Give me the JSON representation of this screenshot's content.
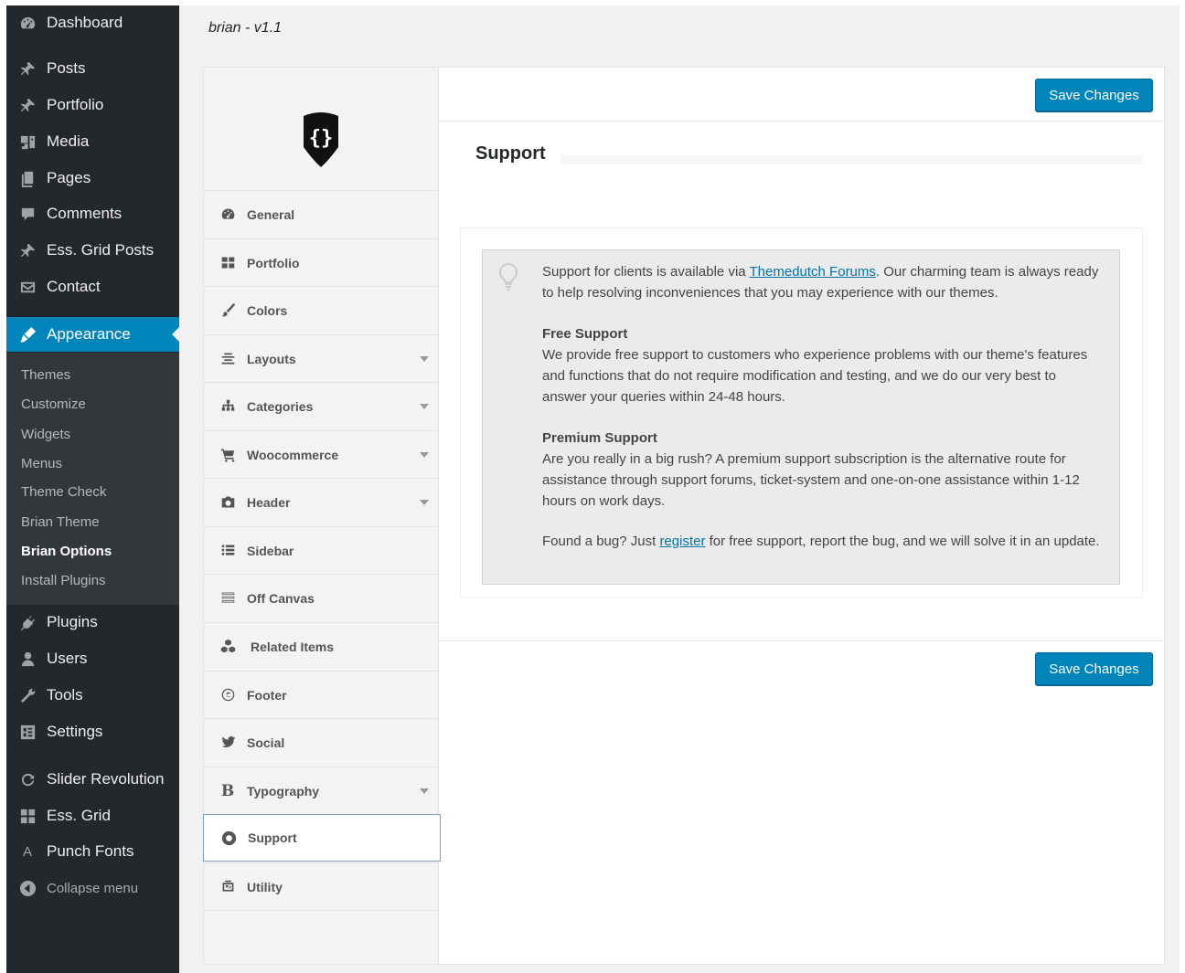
{
  "admin_menu": {
    "items": [
      {
        "label": "Dashboard",
        "icon": "dashboard-icon"
      },
      {
        "label": "Posts",
        "icon": "pin-icon"
      },
      {
        "label": "Portfolio",
        "icon": "pin-icon"
      },
      {
        "label": "Media",
        "icon": "media-icon"
      },
      {
        "label": "Pages",
        "icon": "pages-icon"
      },
      {
        "label": "Comments",
        "icon": "comment-icon"
      },
      {
        "label": "Ess. Grid Posts",
        "icon": "pin-icon"
      },
      {
        "label": "Contact",
        "icon": "mail-icon"
      },
      {
        "label": "Appearance",
        "icon": "brush-icon"
      },
      {
        "label": "Plugins",
        "icon": "plugin-icon"
      },
      {
        "label": "Users",
        "icon": "user-icon"
      },
      {
        "label": "Tools",
        "icon": "wrench-icon"
      },
      {
        "label": "Settings",
        "icon": "settings-icon"
      },
      {
        "label": "Slider Revolution",
        "icon": "refresh-icon"
      },
      {
        "label": "Ess. Grid",
        "icon": "grid-icon"
      },
      {
        "label": "Punch Fonts",
        "icon": "font-icon"
      },
      {
        "label": "Collapse menu",
        "icon": "collapse-icon"
      }
    ],
    "submenu": [
      "Themes",
      "Customize",
      "Widgets",
      "Menus",
      "Theme Check",
      "Brian Theme",
      "Brian Options",
      "Install Plugins"
    ],
    "current_submenu": "Brian Options"
  },
  "page": {
    "title": "brian - v1.1",
    "save_label": "Save Changes",
    "section_title": "Support"
  },
  "options_nav": [
    {
      "label": "General",
      "icon": "dashboard-icon",
      "has_caret": false
    },
    {
      "label": "Portfolio",
      "icon": "grid-icon",
      "has_caret": false
    },
    {
      "label": "Colors",
      "icon": "brush-icon",
      "has_caret": false
    },
    {
      "label": "Layouts",
      "icon": "align-icon",
      "has_caret": true
    },
    {
      "label": "Categories",
      "icon": "sitemap-icon",
      "has_caret": true
    },
    {
      "label": "Woocommerce",
      "icon": "cart-icon",
      "has_caret": true
    },
    {
      "label": "Header",
      "icon": "camera-icon",
      "has_caret": true
    },
    {
      "label": "Sidebar",
      "icon": "list-icon",
      "has_caret": false
    },
    {
      "label": "Off Canvas",
      "icon": "menu-icon",
      "has_caret": false
    },
    {
      "label": "Related Items",
      "icon": "cubes-icon",
      "has_caret": false
    },
    {
      "label": "Footer",
      "icon": "copyright-icon",
      "has_caret": false
    },
    {
      "label": "Social",
      "icon": "twitter-icon",
      "has_caret": false
    },
    {
      "label": "Typography",
      "icon": "bold-icon",
      "has_caret": true
    },
    {
      "label": "Support",
      "icon": "lifebuoy-icon",
      "has_caret": false
    },
    {
      "label": "Utility",
      "icon": "utility-icon",
      "has_caret": false
    }
  ],
  "active_nav": "Support",
  "support": {
    "intro_pre": "Support for clients is available via ",
    "intro_link": "Themedutch Forums",
    "intro_post": ". Our charming team is always ready to help resolving inconveniences that you may experience with our themes.",
    "free_title": "Free Support",
    "free_text": "We provide free support to customers who experience problems with our theme's features and functions that do not require modification and testing, and we do our very best to answer your queries within 24-48 hours.",
    "premium_title": "Premium Support",
    "premium_text": "Are you really in a big rush? A premium support subscription is the alternative route for assistance through support forums, ticket-system and one-on-one assistance within 1-12 hours on work days.",
    "bug_pre": "Found a bug? Just ",
    "bug_link": "register",
    "bug_post": " for free support, report the bug, and we will solve it in an update."
  },
  "colors": {
    "accent": "#0085ba",
    "admin_bg": "#23282d",
    "submenu_bg": "#32373c"
  }
}
